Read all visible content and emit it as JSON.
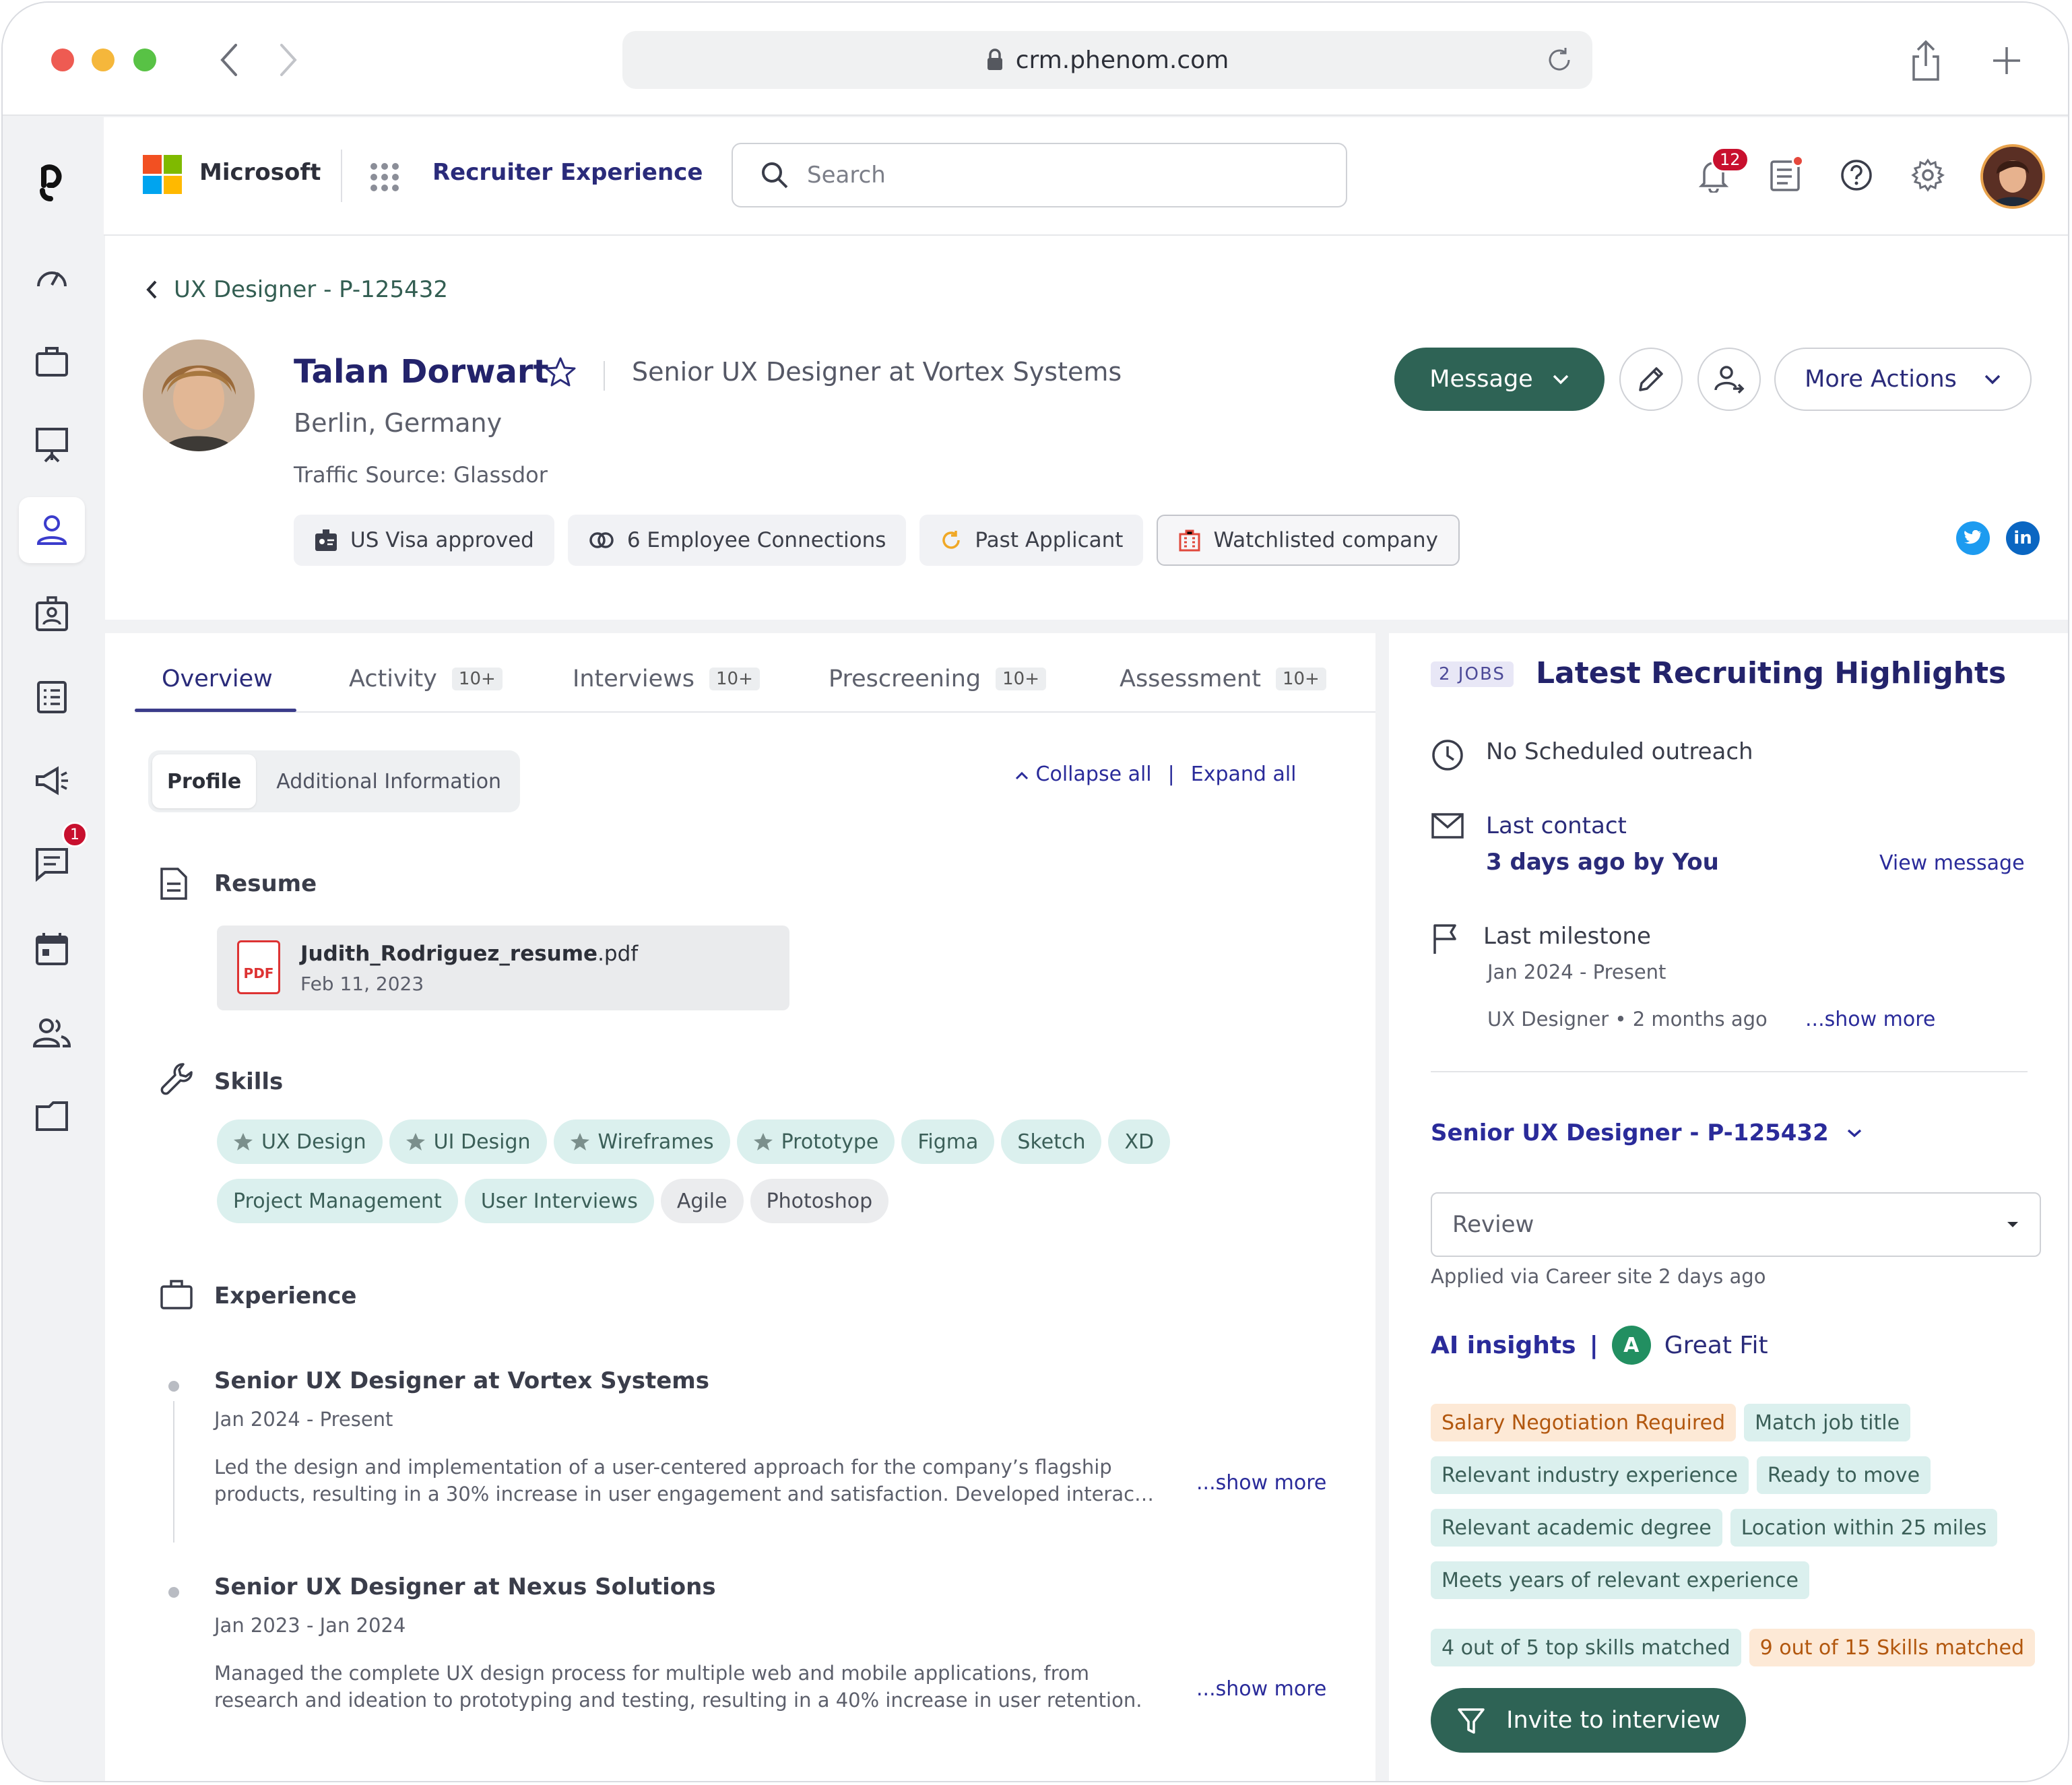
{
  "browser": {
    "url": "crm.phenom.com"
  },
  "topbar": {
    "company": "Microsoft",
    "app_name": "Recruiter Experience",
    "search_placeholder": "Search",
    "notification_count": "12"
  },
  "sidebar": {
    "messages_badge": "1"
  },
  "candidate": {
    "breadcrumb": "UX Designer - P-125432",
    "name": "Talan Dorwart",
    "title": "Senior UX Designer at Vortex Systems",
    "location": "Berlin, Germany",
    "traffic_source": "Traffic Source: Glassdor",
    "chips": [
      "US Visa approved",
      "6 Employee Connections",
      "Past Applicant",
      "Watchlisted company"
    ]
  },
  "actions": {
    "message": "Message",
    "more_actions": "More Actions"
  },
  "tabs": [
    {
      "label": "Overview",
      "count": ""
    },
    {
      "label": "Activity",
      "count": "10+"
    },
    {
      "label": "Interviews",
      "count": "10+"
    },
    {
      "label": "Prescreening",
      "count": "10+"
    },
    {
      "label": "Assessment",
      "count": "10+"
    }
  ],
  "segments": {
    "profile": "Profile",
    "additional": "Additional Information"
  },
  "collapse": {
    "collapse_all": "Collapse all",
    "separator": "|",
    "expand_all": "Expand all"
  },
  "resume": {
    "heading": "Resume",
    "file_base": "Judith_Rodriguez_resume",
    "file_ext": ".pdf",
    "date": "Feb 11, 2023",
    "icon_label": "PDF"
  },
  "skills": {
    "heading": "Skills",
    "starred": [
      "UX Design",
      "UI Design",
      "Wireframes",
      "Prototype"
    ],
    "plain": [
      "Figma",
      "Sketch",
      "XD"
    ],
    "row2": [
      "Project Management",
      "User Interviews"
    ],
    "row2_gray": [
      "Agile",
      "Photoshop"
    ]
  },
  "experience": {
    "heading": "Experience",
    "items": [
      {
        "title": "Senior UX Designer at Vortex Systems",
        "dates": "Jan 2024 - Present",
        "desc1": "Led the design and implementation of a user-centered approach for the company’s flagship",
        "desc2": "products, resulting in a 30% increase in user engagement and satisfaction. Developed interac…",
        "more": "...show more"
      },
      {
        "title": "Senior UX Designer at Nexus Solutions",
        "dates": "Jan 2023 - Jan 2024",
        "desc1": "Managed the complete UX design process for multiple web and mobile applications, from",
        "desc2": "research and ideation to prototyping and testing, resulting in a 40% increase in user retention.",
        "more": "...show more"
      }
    ]
  },
  "highlights": {
    "badge": "2 JOBS",
    "title": "Latest Recruiting Highlights",
    "outreach": "No Scheduled outreach",
    "last_contact_label": "Last contact",
    "last_contact_value": "3 days ago by You",
    "view_message": "View message",
    "milestone_label": "Last milestone",
    "milestone_dates": "Jan 2024 - Present",
    "milestone_detail": "UX Designer • 2 months ago",
    "show_more": "...show more"
  },
  "job": {
    "title": "Senior UX Designer - P-125432",
    "status": "Review",
    "applied": "Applied via Career site 2 days ago"
  },
  "ai": {
    "label": "AI insights",
    "sep": "|",
    "grade": "A",
    "fit": "Great Fit",
    "tags": [
      {
        "text": "Salary Negotiation Required",
        "warn": true
      },
      {
        "text": "Match job title",
        "warn": false
      },
      {
        "text": "Relevant industry experience",
        "warn": false
      },
      {
        "text": "Ready to move",
        "warn": false
      },
      {
        "text": "Relevant academic degree",
        "warn": false
      },
      {
        "text": "Location within 25 miles",
        "warn": false
      },
      {
        "text": "Meets years of relevant experience",
        "warn": false
      },
      {
        "text": "4 out of 5 top skills matched",
        "warn": false
      },
      {
        "text": "9 out of 15 Skills matched",
        "warn": true
      }
    ]
  },
  "invite": {
    "label": "Invite to interview"
  },
  "colors": {
    "primary_green": "#2e6355",
    "brand_navy": "#23236b",
    "link_blue": "#2a2b9a",
    "alert_red": "#c8102e"
  }
}
